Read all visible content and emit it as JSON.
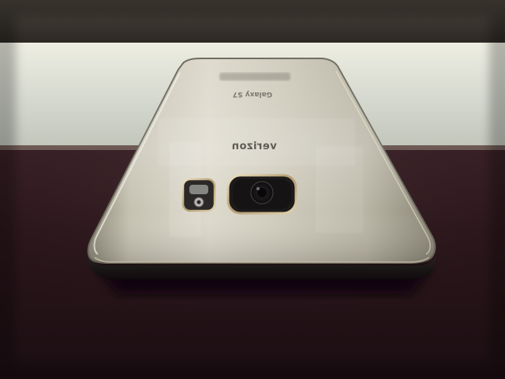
{
  "image": {
    "subject": "phone-back",
    "carrier_logo_text": "verizon",
    "model_text": "Galaxy S7"
  },
  "colors": {
    "wall": "#cfd3c9",
    "wall_top": "#e6e5d9",
    "ceiling": "#3a3630",
    "table": "#2a161c",
    "table_reflection": "#3b2a2d",
    "phone_body": "#b9b5a4",
    "phone_highlight": "#e3e1d7",
    "phone_edge": "#6d6a5e",
    "phone_shadow": "#0c0608",
    "camera_ring": "#c9b48a",
    "camera_lens": "#1a1718"
  }
}
